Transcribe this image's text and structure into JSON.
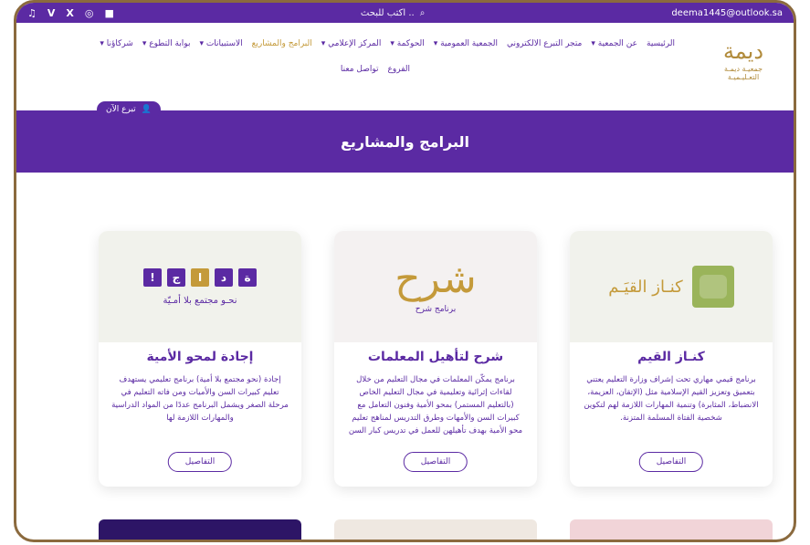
{
  "topbar": {
    "social": [
      "♫",
      "Ⅴ",
      "X",
      "◎",
      "■"
    ],
    "search_placeholder": "اكتب للبحث ..",
    "email": "deema1445@outlook.sa"
  },
  "logo": {
    "text_1": "ديمة",
    "text_2": "جمعيـة ديمـة",
    "text_3": "التعـليـميـة"
  },
  "nav": {
    "row1": [
      "الرئيسية",
      "عن الجمعية ▾",
      "متجر التبرع الالكتروني",
      "الجمعية العمومية ▾",
      "الحوكمة ▾",
      "المركز الإعلامي ▾",
      "البرامج والمشاريع",
      "الاستبيانات ▾",
      "بوابة التطوع ▾",
      "شركاؤنا ▾"
    ],
    "row2": [
      "الفروع",
      "تواصل معنا"
    ],
    "donate_label": "تبرع الآن"
  },
  "hero": {
    "title": "البرامج والمشاريع"
  },
  "cards": [
    {
      "title": "إجادة لمحو الأمية",
      "image_caption": "نحـو مجتمع بلا أمـيّة",
      "desc": "إجادة (نحو مجتمع بلا أمية) برنامج تعليمي يستهدف تعليم كبيرات السن والأميات ومن فاته التعليم في مرحلة الصغر ويشمل البرنامج عددًا من المواد الدراسية والمهارات اللازمة لها",
      "button": "التفاصيل"
    },
    {
      "title": "شرح لتأهيل المعلمات",
      "image_caption": "برنامج شرح",
      "desc": "برنامج يمكّن المعلمات في مجال التعليم من خلال لقاءات إثرائية وتعليمية في مجال التعليم الخاص (بالتعليم المستمر) بمحو الأمية وفنون التعامل مع كبيرات السن والأمهات وطرق التدريس لمناهج تعليم محو الأمية بهدف تأهيلهن للعمل في تدريس كبار السن",
      "button": "التفاصيل"
    },
    {
      "title": "كنـاز القيم",
      "image_caption": "كنـاز القيَـم",
      "desc": "برنامج قيمي مهاري تحت إشراف وزارة التعليم يعتني بتعميق وتعزيز القيم الإسلامية مثل (الإتقان، العزيمة، الانضباط، المثابرة) وتنمية المهارات اللازمة لهم لتكوين شخصية الفتاة المسلمة المتزنة.",
      "button": "التفاصيل"
    }
  ],
  "colors": {
    "primary": "#5b2aa3",
    "gold": "#c49a3a",
    "frame": "#8b6a3e"
  }
}
